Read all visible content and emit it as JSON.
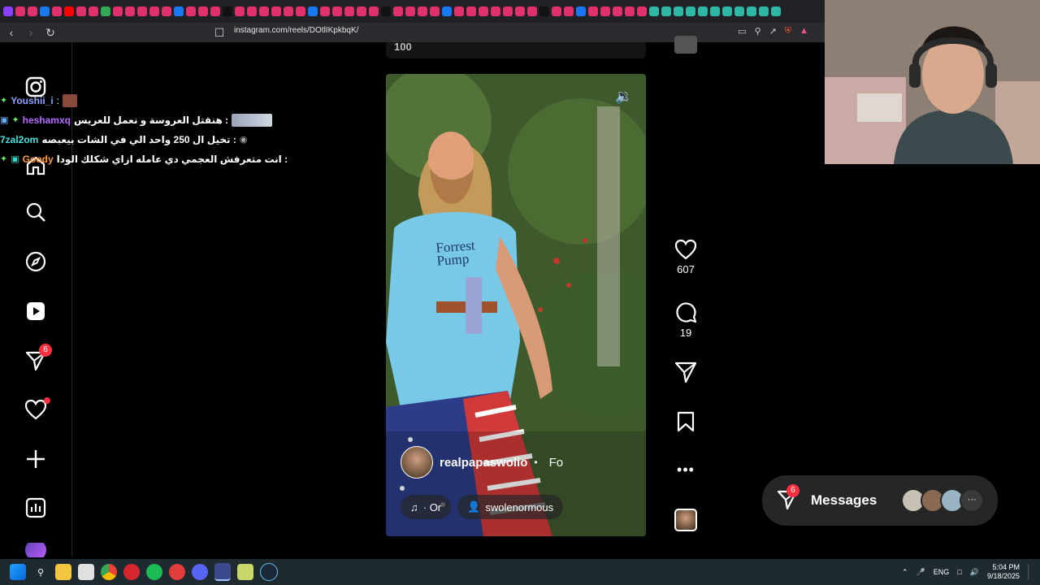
{
  "browser": {
    "url": "instagram.com/reels/DOtlIKpkbqK/"
  },
  "chat": {
    "lines": [
      {
        "user": "Youshii_i",
        "user_color": "#8fa4ff",
        "text": ":"
      },
      {
        "user": "heshamxq",
        "user_color": "#b36bff",
        "text": "هنقتل العروسة و نعمل للعريس :"
      },
      {
        "user": "7zal2om",
        "user_color": "#46e0e0",
        "text": "تخيل ال 250 واحد الي في الشات بيعبصه :"
      },
      {
        "user": "Goody",
        "user_color": "#ff9a3c",
        "text": "انت متعرفش العجمي دي عامله ازاي شكلك الودا :"
      }
    ]
  },
  "sidebar": {
    "notifications_badge": "6"
  },
  "reel": {
    "top_counter": "100",
    "shirt_text_1": "Forrest",
    "shirt_text_2": "Pump",
    "username": "realpapaswolio",
    "dot": "•",
    "follow": "Fo",
    "audio": "· Or",
    "tagged_user": "swolenormous"
  },
  "actions": {
    "likes": "607",
    "comments": "19"
  },
  "messages": {
    "badge": "6",
    "label": "Messages",
    "more": "···"
  },
  "taskbar": {
    "lang": "ENG",
    "time": "5:04 PM",
    "date": "9/18/2025"
  },
  "colors": {
    "like_badge": "#ff3040",
    "tab_favicon": "#e1306c"
  }
}
